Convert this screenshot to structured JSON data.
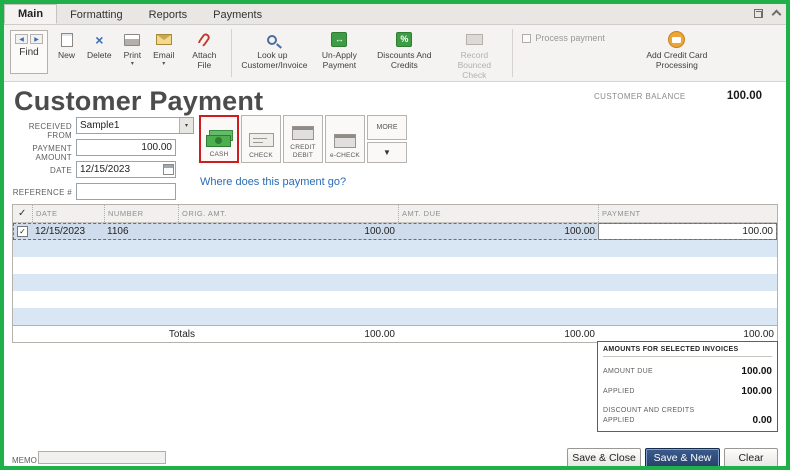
{
  "colors": {
    "frame_green": "#1fb04a",
    "selected_red": "#cf1d1d",
    "save_new_blue": "#2e4d7b",
    "row_blue": "#d9e6f4",
    "link_blue": "#2a6cb3"
  },
  "icons": {
    "dropdown": "▾",
    "triangle_down": "▼",
    "arrow_left": "◀",
    "arrow_right": "▶",
    "delete_x": "×",
    "percent": "%",
    "swap": "↔",
    "checkmark": "✓"
  },
  "tabs": {
    "items": [
      {
        "label": "Main"
      },
      {
        "label": "Formatting"
      },
      {
        "label": "Reports"
      },
      {
        "label": "Payments"
      }
    ]
  },
  "toolbar": {
    "find": "Find",
    "new": "New",
    "delete": "Delete",
    "print": "Print",
    "email": "Email",
    "attach": "Attach File",
    "lookup": "Look up Customer/Invoice",
    "unapply": "Un-Apply Payment",
    "discounts": "Discounts And Credits",
    "record_bounced": "Record Bounced Check",
    "process_payment": "Process payment",
    "add_cc": "Add Credit Card Processing"
  },
  "header": {
    "title": "Customer Payment",
    "customer_balance_label": "CUSTOMER BALANCE",
    "customer_balance_value": "100.00"
  },
  "form": {
    "received_from_label": "RECEIVED FROM",
    "received_from_value": "Sample1",
    "payment_amount_label": "PAYMENT AMOUNT",
    "payment_amount_value": "100.00",
    "date_label": "DATE",
    "date_value": "12/15/2023",
    "reference_label": "REFERENCE #",
    "reference_value": ""
  },
  "payment_methods": [
    {
      "label": "CASH"
    },
    {
      "label": "CHECK"
    },
    {
      "label": "CREDIT DEBIT"
    },
    {
      "label": "e-CHECK"
    },
    {
      "label": "MORE"
    }
  ],
  "link": "Where does this payment go?",
  "table": {
    "headers": [
      "DATE",
      "NUMBER",
      "ORIG. AMT.",
      "AMT. DUE",
      "PAYMENT"
    ],
    "rows": [
      {
        "date": "12/15/2023",
        "number": "1106",
        "orig_amt": "100.00",
        "amt_due": "100.00",
        "payment": "100.00"
      }
    ],
    "totals_label": "Totals",
    "totals": {
      "orig_amt": "100.00",
      "amt_due": "100.00",
      "payment": "100.00"
    }
  },
  "summary": {
    "title": "AMOUNTS FOR SELECTED INVOICES",
    "amount_due_label": "AMOUNT DUE",
    "amount_due": "100.00",
    "applied_label": "APPLIED",
    "applied": "100.00",
    "discount_label": "DISCOUNT AND CREDITS APPLIED",
    "discount": "0.00"
  },
  "footer": {
    "memo_label": "MEMO",
    "save_close": "Save & Close",
    "save_new": "Save & New",
    "clear": "Clear"
  }
}
